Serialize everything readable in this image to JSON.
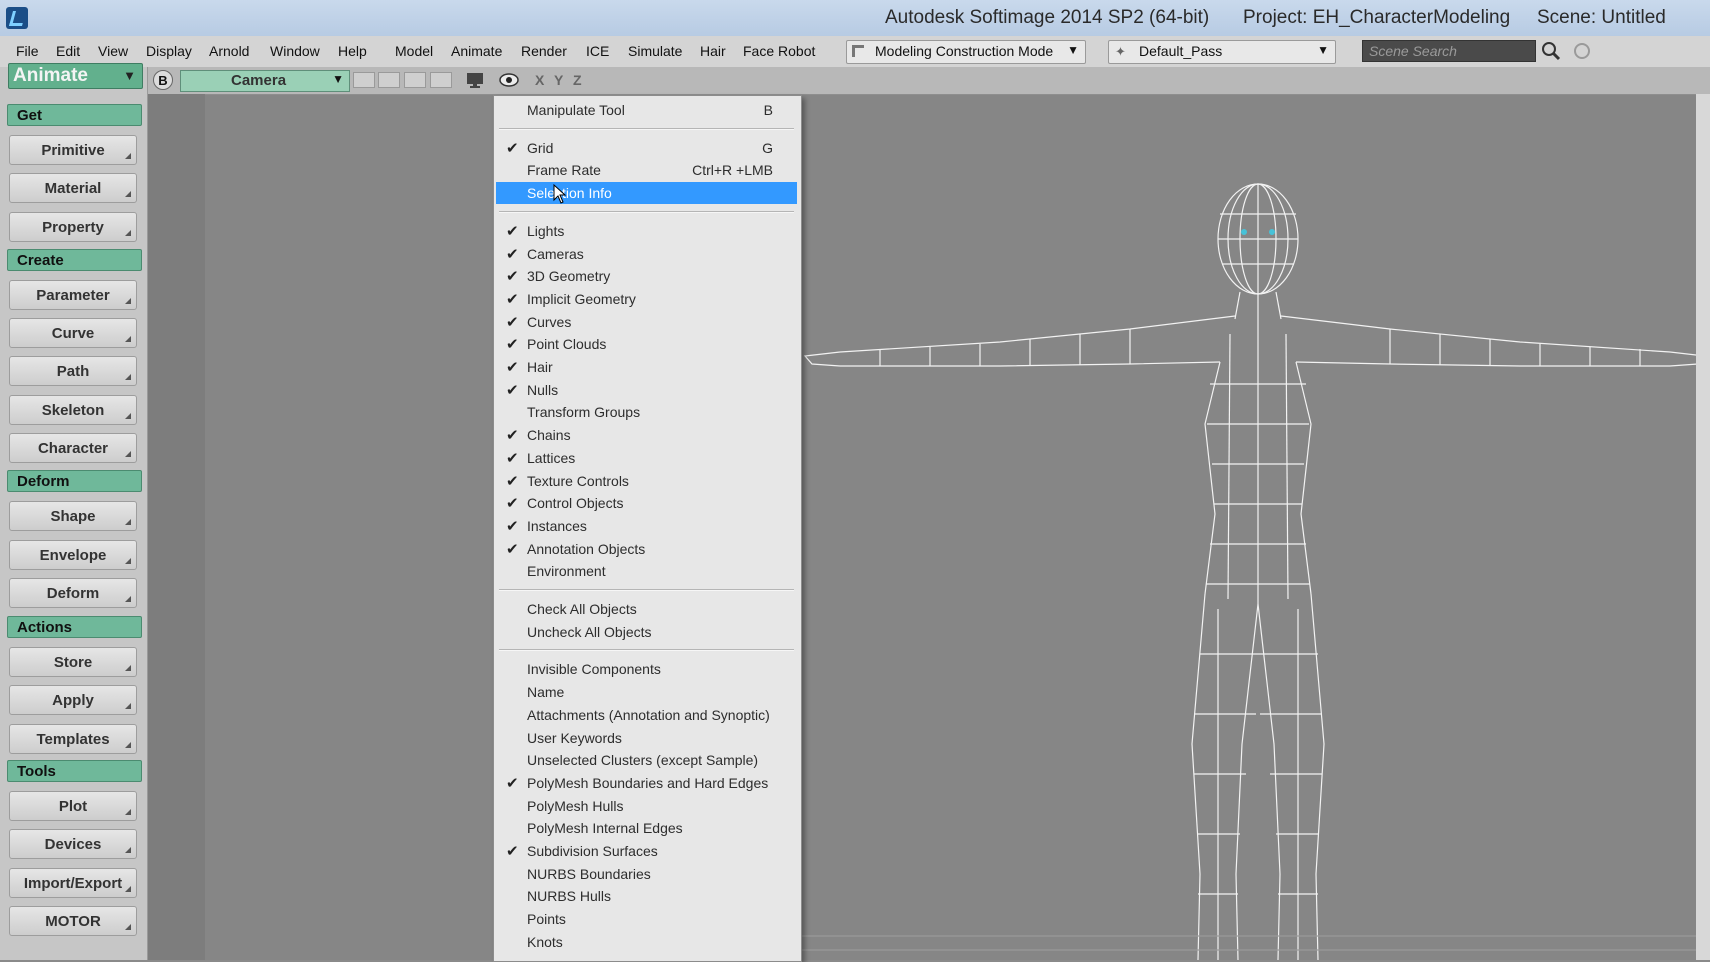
{
  "window": {
    "title": "Autodesk Softimage 2014 SP2 (64-bit)",
    "project": "Project: EH_CharacterModeling",
    "scene": "Scene: Untitled"
  },
  "menubar": {
    "items": [
      "File",
      "Edit",
      "View",
      "Display",
      "Arnold",
      "Window",
      "Help",
      "Model",
      "Animate",
      "Render",
      "ICE",
      "Simulate",
      "Hair",
      "Face Robot"
    ],
    "construction_mode": "Modeling Construction Mode",
    "pass": "Default_Pass",
    "search_placeholder": "Scene Search"
  },
  "left_panel": {
    "mode": "Animate",
    "sections": [
      {
        "header": "Get",
        "buttons": [
          "Primitive",
          "Material",
          "Property"
        ]
      },
      {
        "header": "Create",
        "buttons": [
          "Parameter",
          "Curve",
          "Path",
          "Skeleton",
          "Character"
        ]
      },
      {
        "header": "Deform",
        "buttons": [
          "Shape",
          "Envelope",
          "Deform"
        ]
      },
      {
        "header": "Actions",
        "buttons": [
          "Store",
          "Apply",
          "Templates"
        ]
      },
      {
        "header": "Tools",
        "buttons": [
          "Plot",
          "Devices",
          "Import/Export",
          "MOTOR"
        ]
      }
    ]
  },
  "viewport": {
    "camera": "Camera",
    "axes": [
      "X",
      "Y",
      "Z"
    ],
    "b_label": "B"
  },
  "display_menu": {
    "highlighted": "Selection Info",
    "items": [
      {
        "label": "Manipulate Tool",
        "shortcut": "B",
        "checked": false
      },
      {
        "sep": true
      },
      {
        "label": "Grid",
        "shortcut": "G",
        "checked": true
      },
      {
        "label": "Frame Rate",
        "shortcut": "Ctrl+R +LMB",
        "checked": false
      },
      {
        "label": "Selection Info",
        "shortcut": "",
        "checked": false
      },
      {
        "sep": true
      },
      {
        "label": "Lights",
        "checked": true
      },
      {
        "label": "Cameras",
        "checked": true
      },
      {
        "label": "3D Geometry",
        "checked": true
      },
      {
        "label": "Implicit Geometry",
        "checked": true
      },
      {
        "label": "Curves",
        "checked": true
      },
      {
        "label": "Point Clouds",
        "checked": true
      },
      {
        "label": "Hair",
        "checked": true
      },
      {
        "label": "Nulls",
        "checked": true
      },
      {
        "label": "Transform Groups",
        "checked": false
      },
      {
        "label": "Chains",
        "checked": true
      },
      {
        "label": "Lattices",
        "checked": true
      },
      {
        "label": "Texture Controls",
        "checked": true
      },
      {
        "label": "Control Objects",
        "checked": true
      },
      {
        "label": "Instances",
        "checked": true
      },
      {
        "label": "Annotation Objects",
        "checked": true
      },
      {
        "label": "Environment",
        "checked": false
      },
      {
        "sep": true
      },
      {
        "label": "Check All Objects",
        "checked": false
      },
      {
        "label": "Uncheck All Objects",
        "checked": false
      },
      {
        "sep": true
      },
      {
        "label": "Invisible Components",
        "checked": false
      },
      {
        "label": "Name",
        "checked": false
      },
      {
        "label": "Attachments (Annotation and Synoptic)",
        "checked": false
      },
      {
        "label": "User Keywords",
        "checked": false
      },
      {
        "label": "Unselected Clusters (except Sample)",
        "checked": false
      },
      {
        "label": "PolyMesh Boundaries and Hard Edges",
        "checked": true
      },
      {
        "label": "PolyMesh Hulls",
        "checked": false
      },
      {
        "label": "PolyMesh Internal Edges",
        "checked": false
      },
      {
        "label": "Subdivision Surfaces",
        "checked": true
      },
      {
        "label": "NURBS Boundaries",
        "checked": false
      },
      {
        "label": "NURBS Hulls",
        "checked": false
      },
      {
        "label": "Points",
        "checked": false
      },
      {
        "label": "Knots",
        "checked": false
      }
    ]
  },
  "icons": {
    "app": "softimage-logo-icon",
    "search": "search-icon",
    "refresh": "refresh-icon",
    "eye": "eye-icon",
    "camera_view": "monitor-icon",
    "check": "checkmark-icon"
  },
  "colors": {
    "highlight": "#3399ff",
    "section_green": "#6fb89a",
    "mode_green": "#62b08d",
    "wire": "#f2f2f2"
  }
}
